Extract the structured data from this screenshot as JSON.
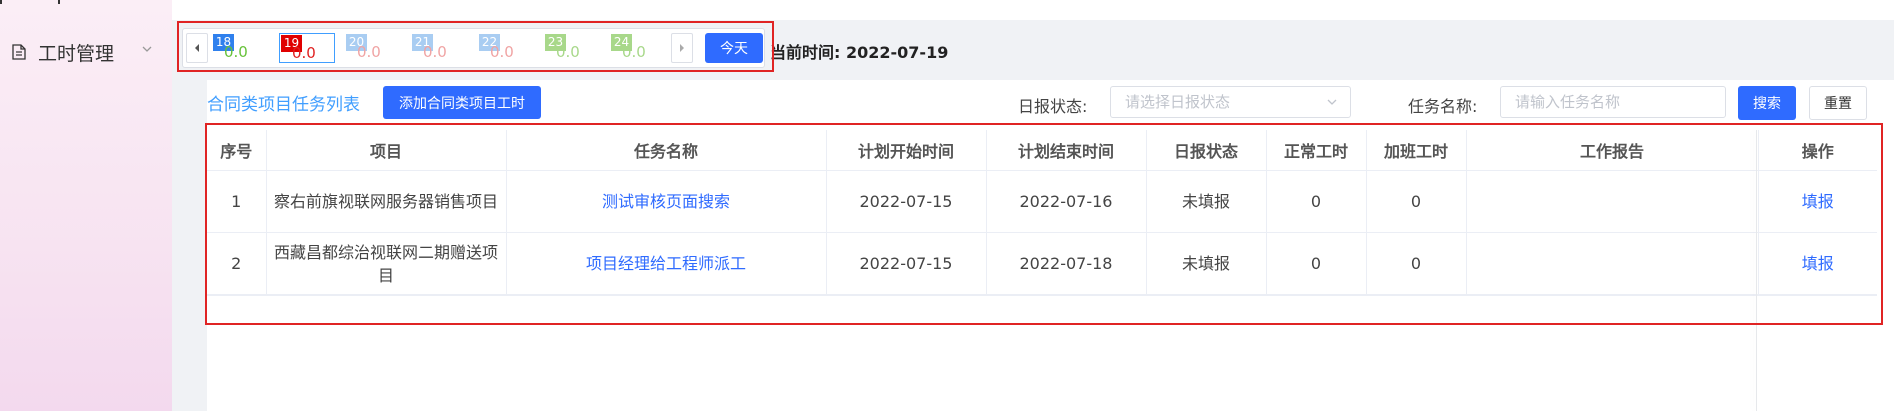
{
  "sidebar": {
    "menu": {
      "label": "工时管理",
      "icon": "document-icon",
      "chevron": "chevron-down-icon"
    }
  },
  "date_bar": {
    "days": [
      {
        "day": "18",
        "value": "0.0",
        "badge_color": "#2f80ed",
        "value_color": "#67c23a"
      },
      {
        "day": "19",
        "value": "0.0",
        "badge_color": "#e00000",
        "value_color": "#e02020",
        "selected": true
      },
      {
        "day": "20",
        "value": "0.0",
        "badge_color": "#a9cdf2",
        "value_color": "#f0a4a4"
      },
      {
        "day": "21",
        "value": "0.0",
        "badge_color": "#a9cdf2",
        "value_color": "#f0a4a4"
      },
      {
        "day": "22",
        "value": "0.0",
        "badge_color": "#a9cdf2",
        "value_color": "#f0a4a4"
      },
      {
        "day": "23",
        "value": "0.0",
        "badge_color": "#a8d88a",
        "value_color": "#a8d88a"
      },
      {
        "day": "24",
        "value": "0.0",
        "badge_color": "#a8d88a",
        "value_color": "#a8d88a"
      }
    ],
    "today_label": "今天",
    "current_time_label": "当前时间:",
    "current_time_value": "2022-07-19"
  },
  "toolbar": {
    "list_title": "合同类项目任务列表",
    "add_button": "添加合同类项目工时",
    "status_label": "日报状态:",
    "status_placeholder": "请选择日报状态",
    "task_label": "任务名称:",
    "task_placeholder": "请输入任务名称",
    "search_button": "搜索",
    "reset_button": "重置"
  },
  "table": {
    "headers": [
      "序号",
      "项目",
      "任务名称",
      "计划开始时间",
      "计划结束时间",
      "日报状态",
      "正常工时",
      "加班工时",
      "工作报告",
      "操作"
    ],
    "rows": [
      {
        "index": "1",
        "project": "察右前旗视联网服务器销售项目",
        "task": "测试审核页面搜索",
        "start": "2022-07-15",
        "end": "2022-07-16",
        "status": "未填报",
        "normal": "0",
        "overtime": "0",
        "report": "",
        "action": "填报"
      },
      {
        "index": "2",
        "project": "西藏昌都综治视联网二期赠送项目",
        "task": "项目经理给工程师派工",
        "start": "2022-07-15",
        "end": "2022-07-18",
        "status": "未填报",
        "normal": "0",
        "overtime": "0",
        "report": "",
        "action": "填报"
      }
    ]
  },
  "colors": {
    "primary": "#2f6bff",
    "highlight_border": "#e02424",
    "link": "#409eff"
  }
}
